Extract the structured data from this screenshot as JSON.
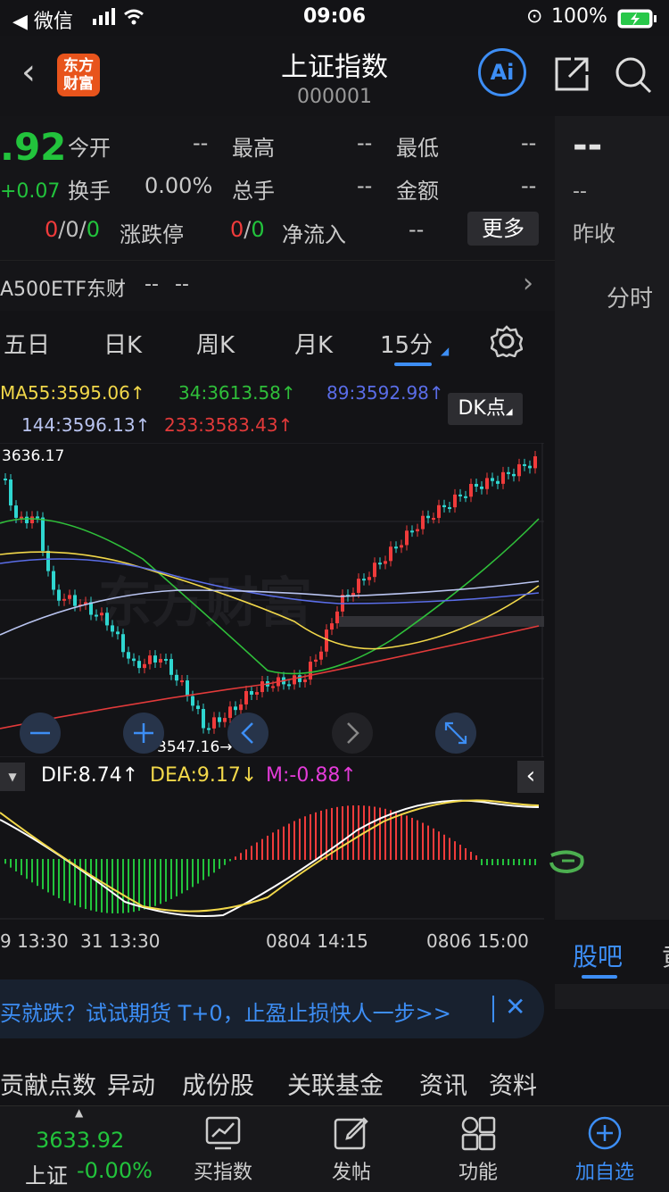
{
  "status": {
    "carrier": "◀ 微信",
    "time": "09:06",
    "battery": "100%"
  },
  "header": {
    "logo_text": "东方财富",
    "title": "上证指数",
    "code": "000001",
    "ai_label": "Ai"
  },
  "quote": {
    "price": ".92",
    "change": "+0.07",
    "rows": [
      {
        "label": "今开",
        "value": "--"
      },
      {
        "label": "最高",
        "value": "--"
      },
      {
        "label": "最低",
        "value": "--"
      },
      {
        "label": "换手",
        "value": "0.00%"
      },
      {
        "label": "总手",
        "value": "--"
      },
      {
        "label": "金额",
        "value": "--"
      }
    ],
    "limit_a": "0",
    "limit_b": "0",
    "limit_c": "0",
    "limit_label": "涨跌停",
    "limit2_a": "0",
    "limit2_b": "0",
    "netflow_label": "净流入",
    "netflow_value": "--",
    "more_label": "更多"
  },
  "right": {
    "big": "--",
    "small": "--",
    "prev_close": "昨收",
    "intraday": "分时",
    "guba": "股吧",
    "cut": "黄"
  },
  "etf": {
    "name": "A500ETF东财",
    "v1": "--",
    "v2": "--"
  },
  "tabs": [
    "五日",
    "日K",
    "周K",
    "月K",
    "15分"
  ],
  "ma": {
    "ma55": "MA55:3595.06↑",
    "ma34": "34:3613.58↑",
    "ma89": "89:3592.98↑",
    "ma144": "144:3596.13↑",
    "ma233": "233:3583.43↑",
    "dk": "DK点"
  },
  "chart_data": {
    "type": "candlestick",
    "high_label": "3636.17",
    "low_label": "3547.16→",
    "watermark": "东方财富",
    "x_ticks": [
      "9 13:30",
      "31 13:30",
      "0804 14:15",
      "0806 15:00"
    ]
  },
  "macd": {
    "dif": "DIF:8.74↑",
    "dea": "DEA:9.17↓",
    "m": "M:-0.88↑"
  },
  "ad": {
    "text": "买就跌？试试期货 T+0，止盈止损快人一步>>"
  },
  "subtabs": [
    "贡献点数",
    "异动",
    "成份股",
    "关联基金",
    "资讯",
    "资料"
  ],
  "bottom": {
    "index_price": "3633.92",
    "index_name": "上证",
    "index_change": "-0.00%",
    "items": [
      "买指数",
      "发帖",
      "功能",
      "加自选"
    ]
  },
  "colors": {
    "up": "#f03b3b",
    "down": "#22c33c",
    "accent": "#3d8ef5"
  }
}
